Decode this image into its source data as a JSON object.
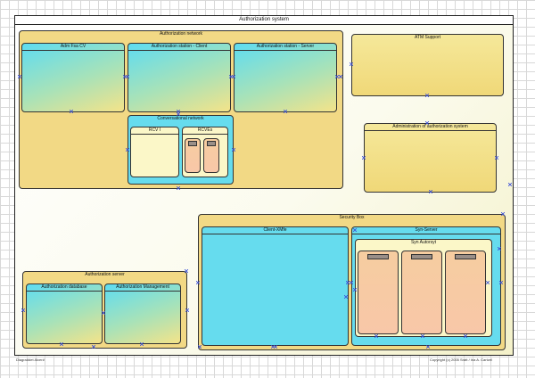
{
  "diagram": {
    "title": "Authorization system",
    "authorization_network": {
      "label": "Authorization network",
      "adm_cv": "Adm Fsa CV",
      "station_client": "Authorization station - Client",
      "station_server": "Authorization station - Server",
      "conversational_network": {
        "label": "Conversational network",
        "left_label": "RCV I",
        "right_label": "RCVEs",
        "chip_a": "",
        "chip_b": ""
      }
    },
    "atm_support": "ATM Support",
    "admin_system": "Administration of authorization system",
    "security_box": {
      "label": "Security Box",
      "client_box": "Client-XMfe",
      "syn_server": {
        "label": "Syn-Server",
        "inner_label": "Syn Autorsyt",
        "chips": [
          "",
          "",
          ""
        ]
      }
    },
    "authorization_server": {
      "label": "Authorization server",
      "database": "Authorization database",
      "management": "Authorization Management"
    },
    "footer_left": "Diagraddet Alcer#",
    "footer_right": "Copyright (c) 2005 Sratt / Ina A. Cartzel"
  }
}
